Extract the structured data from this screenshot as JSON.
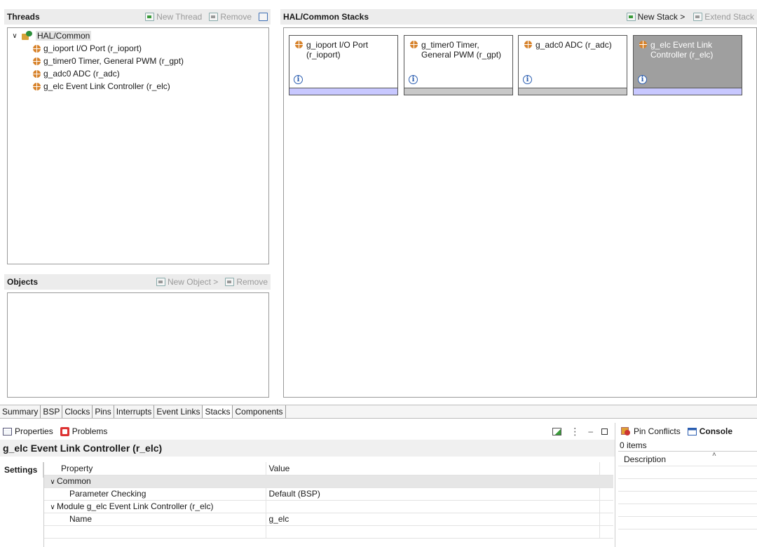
{
  "threads": {
    "title": "Threads",
    "new_thread": "New Thread",
    "remove": "Remove",
    "tree": {
      "root": "HAL/Common",
      "items": [
        "g_ioport I/O Port (r_ioport)",
        "g_timer0 Timer, General PWM (r_gpt)",
        "g_adc0 ADC (r_adc)",
        "g_elc Event Link Controller (r_elc)"
      ]
    }
  },
  "objects": {
    "title": "Objects",
    "new_object": "New Object >",
    "remove": "Remove"
  },
  "stacks": {
    "title": "HAL/Common Stacks",
    "new_stack": "New Stack >",
    "extend_stack": "Extend Stack",
    "cards": [
      {
        "line1": "g_ioport I/O Port",
        "line2": "(r_ioport)",
        "bar_color": "#c8c8ff",
        "selected": false
      },
      {
        "line1": "g_timer0 Timer,",
        "line2": "General PWM (r_gpt)",
        "bar_color": "#c8c8c8",
        "selected": false
      },
      {
        "line1": "g_adc0 ADC (r_adc)",
        "line2": "",
        "bar_color": "#c8c8c8",
        "selected": false
      },
      {
        "line1": "g_elc Event Link",
        "line2": "Controller (r_elc)",
        "bar_color": "#c8c8ff",
        "selected": true
      }
    ],
    "info_glyph": "i"
  },
  "editor_tabs": [
    "Summary",
    "BSP",
    "Clocks",
    "Pins",
    "Interrupts",
    "Event Links",
    "Stacks",
    "Components"
  ],
  "active_editor_tab": "Stacks",
  "properties": {
    "tab_label": "Properties",
    "problems_label": "Problems",
    "title": "g_elc Event Link Controller (r_elc)",
    "side_tab": "Settings",
    "col_property": "Property",
    "col_value": "Value",
    "rows": [
      {
        "property": "Common",
        "value": "",
        "group": true,
        "indent": 1
      },
      {
        "property": "Parameter Checking",
        "value": "Default (BSP)",
        "group": false,
        "indent": 2
      },
      {
        "property": "Module g_elc Event Link Controller (r_elc)",
        "value": "",
        "group": false,
        "indent": 1,
        "chevron": true
      },
      {
        "property": "Name",
        "value": "g_elc",
        "group": false,
        "indent": 2
      }
    ]
  },
  "console": {
    "pin_conflicts": "Pin Conflicts",
    "console_label": "Console",
    "items_count": "0 items",
    "col_description": "Description"
  }
}
